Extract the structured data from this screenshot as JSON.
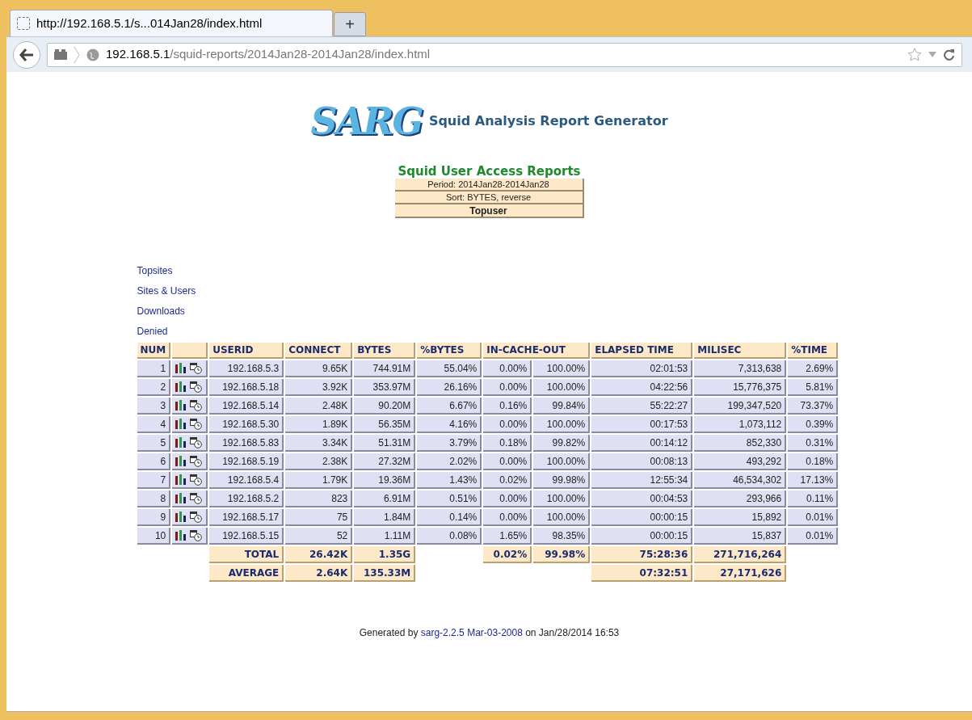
{
  "browser": {
    "tab_title": "http://192.168.5.1/s...014Jan28/index.html",
    "new_tab": "+",
    "url_host": "192.168.5.1",
    "url_path": "/squid-reports/2014Jan28-2014Jan28/index.html"
  },
  "header": {
    "logo": "SARG",
    "title": "Squid Analysis Report Generator"
  },
  "report": {
    "title": "Squid User Access Reports",
    "period": "Period: 2014Jan28-2014Jan28",
    "sort": "Sort: BYTES, reverse",
    "type": "Topuser"
  },
  "links": [
    "Topsites",
    "Sites & Users",
    "Downloads",
    "Denied"
  ],
  "table": {
    "columns": [
      {
        "kind": "text",
        "label": "NUM"
      },
      {
        "kind": "icons"
      },
      {
        "kind": "text",
        "label": "USERID"
      },
      {
        "kind": "text",
        "label": "CONNECT"
      },
      {
        "kind": "text",
        "label": "BYTES"
      },
      {
        "kind": "text",
        "label": "%BYTES"
      },
      {
        "kind": "span",
        "label": "IN-CACHE-OUT"
      },
      {
        "kind": "text",
        "label": "ELAPSED TIME"
      },
      {
        "kind": "text",
        "label": "MILISEC"
      },
      {
        "kind": "text",
        "label": "%TIME"
      }
    ],
    "rows": [
      {
        "num": "1",
        "userid": "192.168.5.3",
        "connect": "9.65K",
        "bytes": "744.91M",
        "pct_bytes": "55.04%",
        "in_cache": "0.00%",
        "out_cache": "100.00%",
        "elapsed": "02:01:53",
        "milisec": "7,313,638",
        "pct_time": "2.69%"
      },
      {
        "num": "2",
        "userid": "192.168.5.18",
        "connect": "3.92K",
        "bytes": "353.97M",
        "pct_bytes": "26.16%",
        "in_cache": "0.00%",
        "out_cache": "100.00%",
        "elapsed": "04:22:56",
        "milisec": "15,776,375",
        "pct_time": "5.81%"
      },
      {
        "num": "3",
        "userid": "192.168.5.14",
        "connect": "2.48K",
        "bytes": "90.20M",
        "pct_bytes": "6.67%",
        "in_cache": "0.16%",
        "out_cache": "99.84%",
        "elapsed": "55:22:27",
        "milisec": "199,347,520",
        "pct_time": "73.37%"
      },
      {
        "num": "4",
        "userid": "192.168.5.30",
        "connect": "1.89K",
        "bytes": "56.35M",
        "pct_bytes": "4.16%",
        "in_cache": "0.00%",
        "out_cache": "100.00%",
        "elapsed": "00:17:53",
        "milisec": "1,073,112",
        "pct_time": "0.39%"
      },
      {
        "num": "5",
        "userid": "192.168.5.83",
        "connect": "3.34K",
        "bytes": "51.31M",
        "pct_bytes": "3.79%",
        "in_cache": "0.18%",
        "out_cache": "99.82%",
        "elapsed": "00:14:12",
        "milisec": "852,330",
        "pct_time": "0.31%"
      },
      {
        "num": "6",
        "userid": "192.168.5.19",
        "connect": "2.38K",
        "bytes": "27.32M",
        "pct_bytes": "2.02%",
        "in_cache": "0.00%",
        "out_cache": "100.00%",
        "elapsed": "00:08:13",
        "milisec": "493,292",
        "pct_time": "0.18%"
      },
      {
        "num": "7",
        "userid": "192.168.5.4",
        "connect": "1.79K",
        "bytes": "19.36M",
        "pct_bytes": "1.43%",
        "in_cache": "0.02%",
        "out_cache": "99.98%",
        "elapsed": "12:55:34",
        "milisec": "46,534,302",
        "pct_time": "17.13%"
      },
      {
        "num": "8",
        "userid": "192.168.5.2",
        "connect": "823",
        "bytes": "6.91M",
        "pct_bytes": "0.51%",
        "in_cache": "0.00%",
        "out_cache": "100.00%",
        "elapsed": "00:04:53",
        "milisec": "293,966",
        "pct_time": "0.11%"
      },
      {
        "num": "9",
        "userid": "192.168.5.17",
        "connect": "75",
        "bytes": "1.84M",
        "pct_bytes": "0.14%",
        "in_cache": "0.00%",
        "out_cache": "100.00%",
        "elapsed": "00:00:15",
        "milisec": "15,892",
        "pct_time": "0.01%"
      },
      {
        "num": "10",
        "userid": "192.168.5.15",
        "connect": "52",
        "bytes": "1.11M",
        "pct_bytes": "0.08%",
        "in_cache": "1.65%",
        "out_cache": "98.35%",
        "elapsed": "00:00:15",
        "milisec": "15,837",
        "pct_time": "0.01%"
      }
    ],
    "total": {
      "label": "TOTAL",
      "connect": "26.42K",
      "bytes": "1.35G",
      "in_cache": "0.02%",
      "out_cache": "99.98%",
      "elapsed": "75:28:36",
      "milisec": "271,716,264"
    },
    "average": {
      "label": "AVERAGE",
      "connect": "2.64K",
      "bytes": "135.33M",
      "elapsed": "07:32:51",
      "milisec": "27,171,626"
    }
  },
  "footer": {
    "prefix": "Generated by",
    "link": "sarg-2.2.5 Mar-03-2008",
    "suffix": "on Jan/28/2014 16:53"
  }
}
